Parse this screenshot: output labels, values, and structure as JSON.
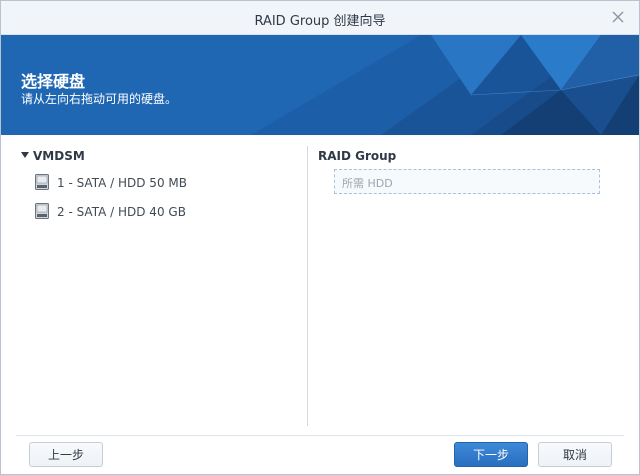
{
  "window": {
    "title": "RAID Group 创建向导"
  },
  "banner": {
    "title": "选择硬盘",
    "subtitle": "请从左向右拖动可用的硬盘。"
  },
  "source_tree": {
    "root_label": "VMDSM",
    "items": [
      {
        "label": "1 - SATA / HDD 50 MB",
        "icon": "hdd-icon"
      },
      {
        "label": "2 - SATA / HDD 40 GB",
        "icon": "hdd-icon"
      }
    ]
  },
  "target": {
    "title": "RAID Group",
    "placeholder": "所需 HDD"
  },
  "footer": {
    "back_label": "上一步",
    "next_label": "下一步",
    "cancel_label": "取消"
  },
  "colors": {
    "banner": "#1f66b3",
    "primary_button": "#2a6fbf",
    "drop_zone_border": "#a9c2db"
  }
}
